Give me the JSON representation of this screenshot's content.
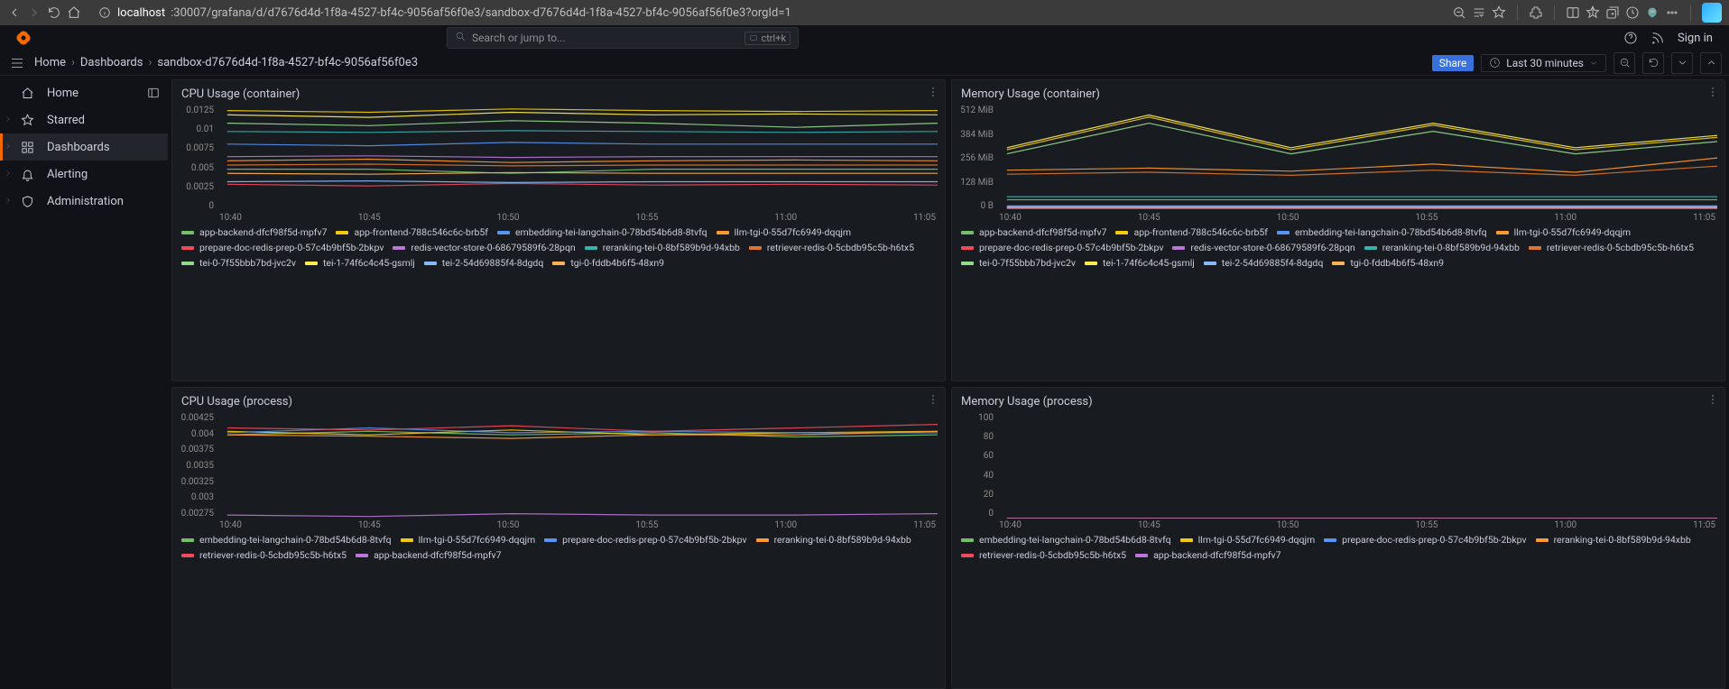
{
  "browser": {
    "url_host": "localhost",
    "url_path": ":30007/grafana/d/d7676d4d-1f8a-4527-bf4c-9056af56f0e3/sandbox-d7676d4d-1f8a-4527-bf4c-9056af56f0e3?orgId=1"
  },
  "search": {
    "placeholder": "Search or jump to...",
    "shortcut": "ctrl+k"
  },
  "topright": {
    "signin": "Sign in"
  },
  "breadcrumb": {
    "home": "Home",
    "dash": "Dashboards",
    "current": "sandbox-d7676d4d-1f8a-4527-bf4c-9056af56f0e3"
  },
  "toolbar": {
    "share": "Share",
    "time": "Last 30 minutes"
  },
  "sidebar": {
    "items": [
      {
        "label": "Home"
      },
      {
        "label": "Starred"
      },
      {
        "label": "Dashboards"
      },
      {
        "label": "Alerting"
      },
      {
        "label": "Administration"
      }
    ]
  },
  "xticks": [
    "10:40",
    "10:45",
    "10:50",
    "10:55",
    "11:00",
    "11:05"
  ],
  "colors": {
    "green": "#73bf69",
    "yellow": "#f2cc0c",
    "blue": "#5794f2",
    "orange": "#ff9830",
    "red": "#f2495c",
    "purple": "#b877d9",
    "teal": "#37b0b0",
    "darkorange": "#e0752d",
    "lime": "#96d98d",
    "lightyellow": "#ffee52",
    "lightblue": "#8ab8ff",
    "peach": "#ffb357",
    "pink": "#ff85a1",
    "lilac": "#d0a6e8",
    "cyan": "#6ed0e0"
  },
  "series_full": [
    {
      "name": "app-backend-dfcf98f5d-mpfv7",
      "colorKey": "green"
    },
    {
      "name": "app-frontend-788c546c6c-brb5f",
      "colorKey": "yellow"
    },
    {
      "name": "embedding-tei-langchain-0-78bd54b6d8-8tvfq",
      "colorKey": "blue"
    },
    {
      "name": "llm-tgi-0-55d7fc6949-dqqjm",
      "colorKey": "orange"
    },
    {
      "name": "prepare-doc-redis-prep-0-57c4b9bf5b-2bkpv",
      "colorKey": "red"
    },
    {
      "name": "redis-vector-store-0-68679589f6-28pqn",
      "colorKey": "purple"
    },
    {
      "name": "reranking-tei-0-8bf589b9d-94xbb",
      "colorKey": "teal"
    },
    {
      "name": "retriever-redis-0-5cbdb95c5b-h6tx5",
      "colorKey": "darkorange"
    },
    {
      "name": "tei-0-7f55bbb7bd-jvc2v",
      "colorKey": "lime"
    },
    {
      "name": "tei-1-74f6c4c45-gsmlj",
      "colorKey": "lightyellow"
    },
    {
      "name": "tei-2-54d69885f4-8dgdq",
      "colorKey": "lightblue"
    },
    {
      "name": "tgi-0-fddb4b6f5-48xn9",
      "colorKey": "peach"
    }
  ],
  "series_sub": [
    {
      "name": "embedding-tei-langchain-0-78bd54b6d8-8tvfq",
      "colorKey": "green"
    },
    {
      "name": "llm-tgi-0-55d7fc6949-dqqjm",
      "colorKey": "yellow"
    },
    {
      "name": "prepare-doc-redis-prep-0-57c4b9bf5b-2bkpv",
      "colorKey": "blue"
    },
    {
      "name": "reranking-tei-0-8bf589b9d-94xbb",
      "colorKey": "orange"
    },
    {
      "name": "retriever-redis-0-5cbdb95c5b-h6tx5",
      "colorKey": "red"
    },
    {
      "name": "app-backend-dfcf98f5d-mpfv7",
      "colorKey": "purple"
    }
  ],
  "panels": [
    {
      "title": "CPU Usage (container)",
      "yticks": [
        "0.0125",
        "0.01",
        "0.0075",
        "0.005",
        "0.0025",
        "0"
      ],
      "legend": "full",
      "chart_data": {
        "type": "line",
        "xlabel": "",
        "ylabel": "",
        "ylim": [
          0,
          0.0125
        ],
        "x": [
          "10:40",
          "10:45",
          "10:50",
          "10:55",
          "11:00",
          "11:05"
        ],
        "series": [
          {
            "name": "app-backend-dfcf98f5d-mpfv7",
            "values": [
              0.005,
              0.005,
              0.0045,
              0.005,
              0.005,
              0.005
            ]
          },
          {
            "name": "app-frontend-788c546c6c-brb5f",
            "values": [
              0.012,
              0.0118,
              0.0122,
              0.012,
              0.0119,
              0.012
            ]
          },
          {
            "name": "embedding-tei-langchain-0-78bd54b6d8-8tvfq",
            "values": [
              0.008,
              0.0078,
              0.0082,
              0.008,
              0.008,
              0.008
            ]
          },
          {
            "name": "llm-tgi-0-55d7fc6949-dqqjm",
            "values": [
              0.006,
              0.0062,
              0.0058,
              0.006,
              0.0061,
              0.006
            ]
          },
          {
            "name": "prepare-doc-redis-prep-0-57c4b9bf5b-2bkpv",
            "values": [
              0.0032,
              0.003,
              0.0033,
              0.0031,
              0.0032,
              0.0031
            ]
          },
          {
            "name": "redis-vector-store-0-68679589f6-28pqn",
            "values": [
              0.0065,
              0.0066,
              0.0064,
              0.0065,
              0.0065,
              0.0065
            ]
          },
          {
            "name": "reranking-tei-0-8bf589b9d-94xbb",
            "values": [
              0.0095,
              0.0094,
              0.0096,
              0.0095,
              0.0094,
              0.0095
            ]
          },
          {
            "name": "retriever-redis-0-5cbdb95c5b-h6tx5",
            "values": [
              0.0055,
              0.0056,
              0.0054,
              0.0055,
              0.0055,
              0.0055
            ]
          },
          {
            "name": "tei-0-7f55bbb7bd-jvc2v",
            "values": [
              0.0105,
              0.0102,
              0.0108,
              0.0105,
              0.01,
              0.0105
            ]
          },
          {
            "name": "tei-1-74f6c4c45-gsmlj",
            "values": [
              0.0115,
              0.0112,
              0.0118,
              0.0115,
              0.0116,
              0.0115
            ]
          },
          {
            "name": "tei-2-54d69885f4-8dgdq",
            "values": [
              0.0035,
              0.0036,
              0.0034,
              0.0035,
              0.0035,
              0.0035
            ]
          },
          {
            "name": "tgi-0-fddb4b6f5-48xn9",
            "values": [
              0.0045,
              0.0044,
              0.0046,
              0.0045,
              0.0045,
              0.0045
            ]
          }
        ]
      }
    },
    {
      "title": "Memory Usage (container)",
      "yticks": [
        "512 MiB",
        "384 MiB",
        "256 MiB",
        "128 MiB",
        "0 B"
      ],
      "legend": "full",
      "chart_data": {
        "type": "line",
        "xlabel": "",
        "ylabel": "",
        "ylim": [
          0,
          512
        ],
        "unit": "MiB",
        "x": [
          "10:40",
          "10:45",
          "10:50",
          "10:55",
          "11:00",
          "11:05"
        ],
        "series": [
          {
            "name": "app-backend-dfcf98f5d-mpfv7",
            "values": [
              55,
              55,
              55,
              55,
              55,
              55
            ]
          },
          {
            "name": "app-frontend-788c546c6c-brb5f",
            "values": [
              300,
              460,
              300,
              420,
              300,
              360
            ]
          },
          {
            "name": "embedding-tei-langchain-0-78bd54b6d8-8tvfq",
            "values": [
              20,
              20,
              20,
              20,
              20,
              20
            ]
          },
          {
            "name": "llm-tgi-0-55d7fc6949-dqqjm",
            "values": [
              200,
              210,
              195,
              230,
              190,
              260
            ]
          },
          {
            "name": "prepare-doc-redis-prep-0-57c4b9bf5b-2bkpv",
            "values": [
              12,
              12,
              12,
              12,
              12,
              12
            ]
          },
          {
            "name": "redis-vector-store-0-68679589f6-28pqn",
            "values": [
              15,
              15,
              15,
              15,
              15,
              15
            ]
          },
          {
            "name": "reranking-tei-0-8bf589b9d-94xbb",
            "values": [
              70,
              70,
              70,
              70,
              70,
              70
            ]
          },
          {
            "name": "retriever-redis-0-5cbdb95c5b-h6tx5",
            "values": [
              180,
              190,
              175,
              200,
              175,
              220
            ]
          },
          {
            "name": "tei-0-7f55bbb7bd-jvc2v",
            "values": [
              280,
              430,
              280,
              390,
              280,
              340
            ]
          },
          {
            "name": "tei-1-74f6c4c45-gsmlj",
            "values": [
              310,
              470,
              310,
              430,
              310,
              370
            ]
          },
          {
            "name": "tei-2-54d69885f4-8dgdq",
            "values": [
              25,
              25,
              25,
              25,
              25,
              25
            ]
          },
          {
            "name": "tgi-0-fddb4b6f5-48xn9",
            "values": [
              18,
              18,
              18,
              18,
              18,
              18
            ]
          }
        ]
      }
    },
    {
      "title": "CPU Usage (process)",
      "yticks": [
        "0.00425",
        "0.004",
        "0.00375",
        "0.0035",
        "0.00325",
        "0.003",
        "0.00275"
      ],
      "legend": "sub",
      "chart_data": {
        "type": "line",
        "xlabel": "",
        "ylabel": "",
        "ylim": [
          0.00275,
          0.00425
        ],
        "x": [
          "10:40",
          "10:45",
          "10:50",
          "10:55",
          "11:00",
          "11:05"
        ],
        "series": [
          {
            "name": "embedding-tei-langchain-0-78bd54b6d8-8tvfq",
            "values": [
              0.00395,
              0.004,
              0.00395,
              0.00398,
              0.00392,
              0.00395
            ]
          },
          {
            "name": "llm-tgi-0-55d7fc6949-dqqjm",
            "values": [
              0.004,
              0.00395,
              0.00402,
              0.00395,
              0.00398,
              0.004
            ]
          },
          {
            "name": "prepare-doc-redis-prep-0-57c4b9bf5b-2bkpv",
            "values": [
              0.00398,
              0.00405,
              0.00398,
              0.004,
              0.00398,
              0.00398
            ]
          },
          {
            "name": "reranking-tei-0-8bf589b9d-94xbb",
            "values": [
              0.00395,
              0.00393,
              0.0039,
              0.00395,
              0.00395,
              0.004
            ]
          },
          {
            "name": "retriever-redis-0-5cbdb95c5b-h6tx5",
            "values": [
              0.00405,
              0.00402,
              0.00408,
              0.004,
              0.00405,
              0.0041
            ]
          },
          {
            "name": "app-backend-dfcf98f5d-mpfv7",
            "values": [
              0.0028,
              0.00278,
              0.00282,
              0.0028,
              0.0028,
              0.00282
            ]
          }
        ]
      }
    },
    {
      "title": "Memory Usage (process)",
      "yticks": [
        "100",
        "80",
        "60",
        "40",
        "20",
        "0"
      ],
      "legend": "sub",
      "chart_data": {
        "type": "line",
        "xlabel": "",
        "ylabel": "",
        "ylim": [
          0,
          100
        ],
        "x": [
          "10:40",
          "10:45",
          "10:50",
          "10:55",
          "11:00",
          "11:05"
        ],
        "series": [
          {
            "name": "embedding-tei-langchain-0-78bd54b6d8-8tvfq",
            "values": [
              0,
              0,
              0,
              0,
              0,
              0
            ]
          },
          {
            "name": "llm-tgi-0-55d7fc6949-dqqjm",
            "values": [
              0,
              0,
              0,
              0,
              0,
              0
            ]
          },
          {
            "name": "prepare-doc-redis-prep-0-57c4b9bf5b-2bkpv",
            "values": [
              0,
              0,
              0,
              0,
              0,
              0
            ]
          },
          {
            "name": "reranking-tei-0-8bf589b9d-94xbb",
            "values": [
              0,
              0,
              0,
              0,
              0,
              0
            ]
          },
          {
            "name": "retriever-redis-0-5cbdb95c5b-h6tx5",
            "values": [
              0,
              0,
              0,
              0,
              0,
              0
            ]
          },
          {
            "name": "app-backend-dfcf98f5d-mpfv7",
            "values": [
              0,
              0,
              0,
              0,
              0,
              0
            ]
          }
        ]
      }
    }
  ]
}
